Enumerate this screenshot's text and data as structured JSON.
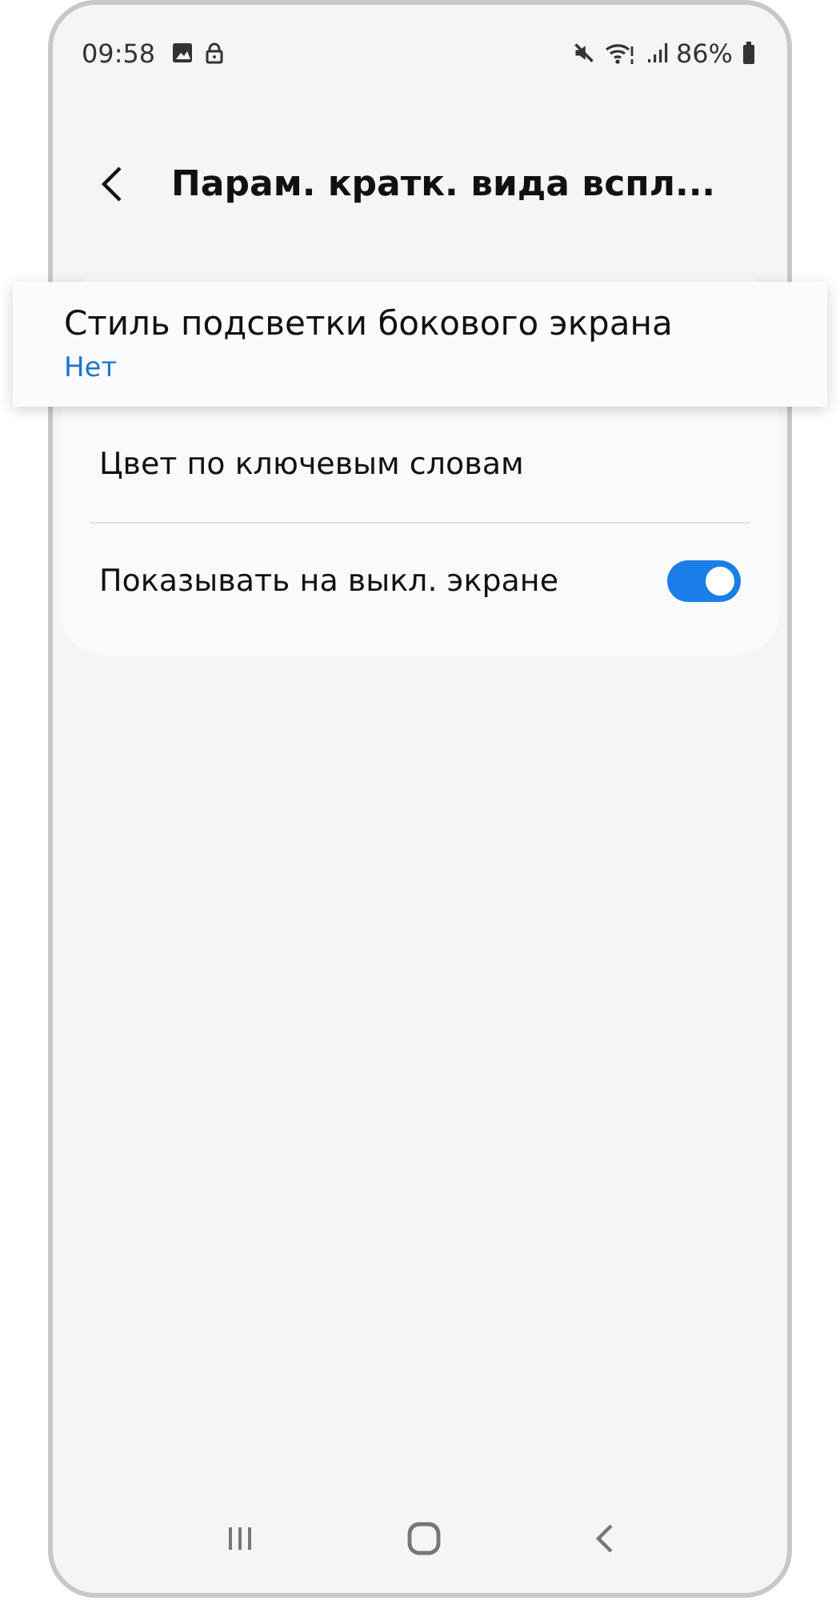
{
  "status_bar": {
    "time": "09:58",
    "battery": "86%"
  },
  "header": {
    "title": "Парам. кратк. вида вспл..."
  },
  "items": [
    {
      "kind": "option",
      "title": "Стиль подсветки бокового экрана",
      "value": "Нет",
      "highlighted": true
    },
    {
      "kind": "link",
      "title": "Цвет по ключевым словам",
      "highlighted": false
    },
    {
      "kind": "switch",
      "title": "Показывать на выкл. экране",
      "on": true,
      "highlighted": false
    }
  ]
}
